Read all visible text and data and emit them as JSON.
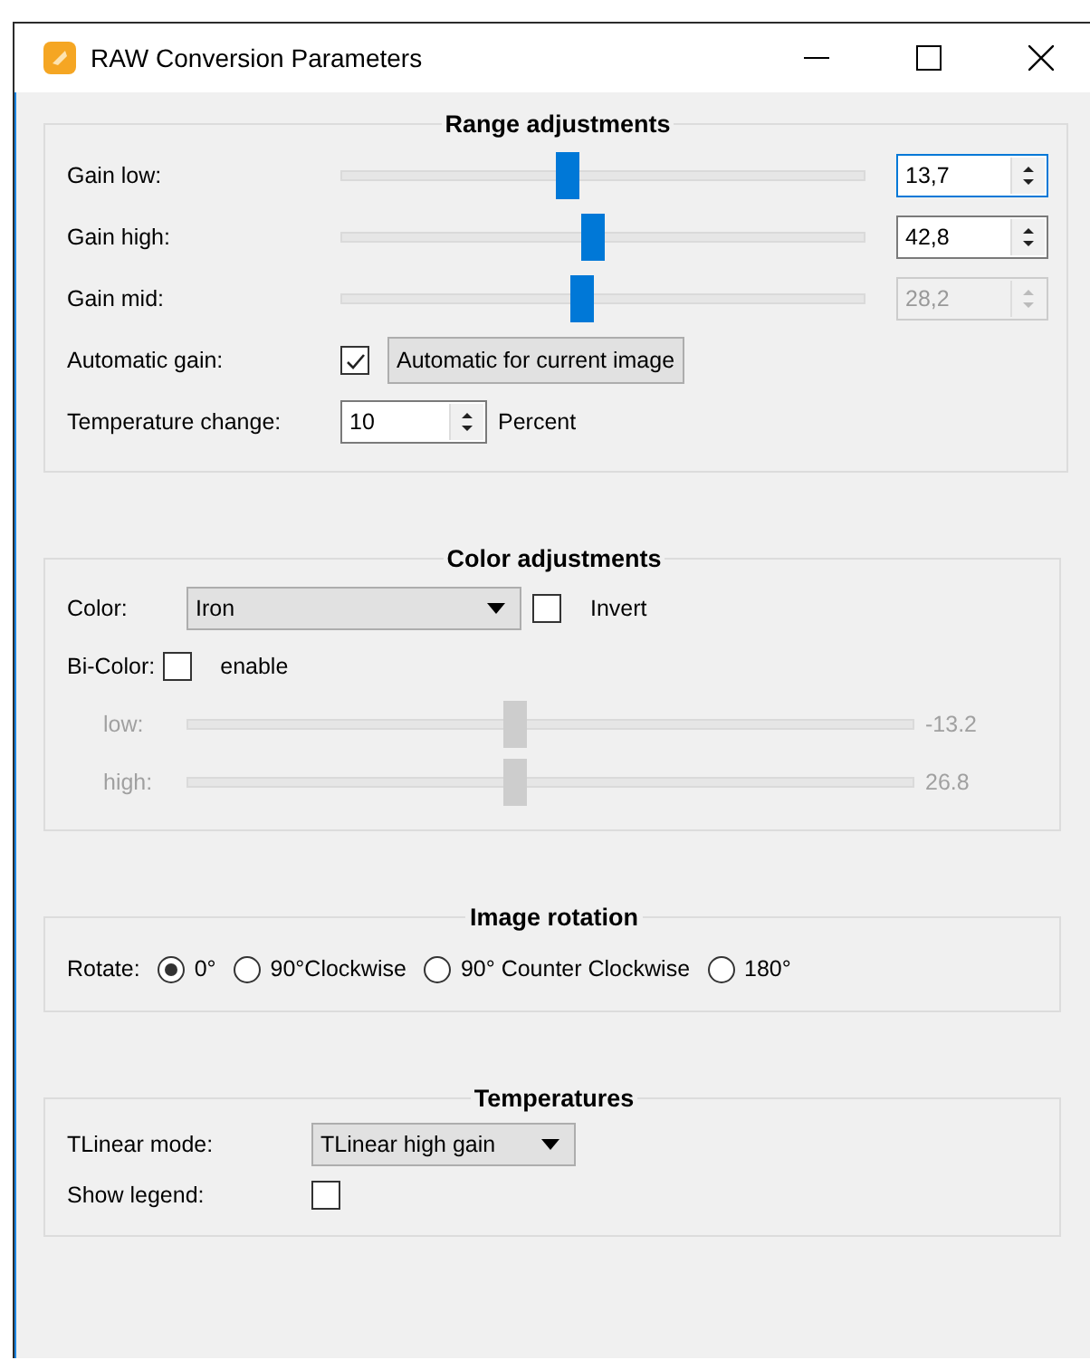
{
  "window": {
    "title": "RAW Conversion Parameters"
  },
  "range": {
    "title": "Range adjustments",
    "sliders": [
      {
        "label": "Gain low:",
        "level": 0.43,
        "value": "13,7",
        "disabled": false,
        "focused": true
      },
      {
        "label": "Gain high:",
        "level": 0.48,
        "value": "42,8",
        "disabled": false,
        "focused": false
      },
      {
        "label": "Gain mid:",
        "level": 0.46,
        "value": "28,2",
        "disabled": true,
        "focused": false
      }
    ],
    "automatic_gain": {
      "label": "Automatic gain:",
      "checked": true,
      "button": "Automatic for current image"
    },
    "temperature_change": {
      "label": "Temperature change:",
      "value": "10",
      "unit": "Percent"
    }
  },
  "color": {
    "title": "Color adjustments",
    "label": "Color:",
    "value": "Iron",
    "invert": {
      "label": "Invert",
      "checked": false
    },
    "bicolor": {
      "label": "Bi-Color:",
      "option": "enable",
      "checked": false
    },
    "sliders": [
      {
        "label": "low:",
        "level": 0.45,
        "reading": "-13.2",
        "disabled": true
      },
      {
        "label": "high:",
        "level": 0.45,
        "reading": "26.8",
        "disabled": true
      }
    ]
  },
  "rotation": {
    "title": "Image rotation",
    "label": "Rotate:",
    "options": [
      {
        "label": "0°",
        "selected": true
      },
      {
        "label": "90°Clockwise",
        "selected": false
      },
      {
        "label": "90° Counter Clockwise",
        "selected": false
      },
      {
        "label": "180°",
        "selected": false
      }
    ]
  },
  "temperatures": {
    "title": "Temperatures",
    "mode_label": "TLinear mode:",
    "mode": "TLinear high gain",
    "legend_label": "Show legend:",
    "legend_checked": false
  }
}
